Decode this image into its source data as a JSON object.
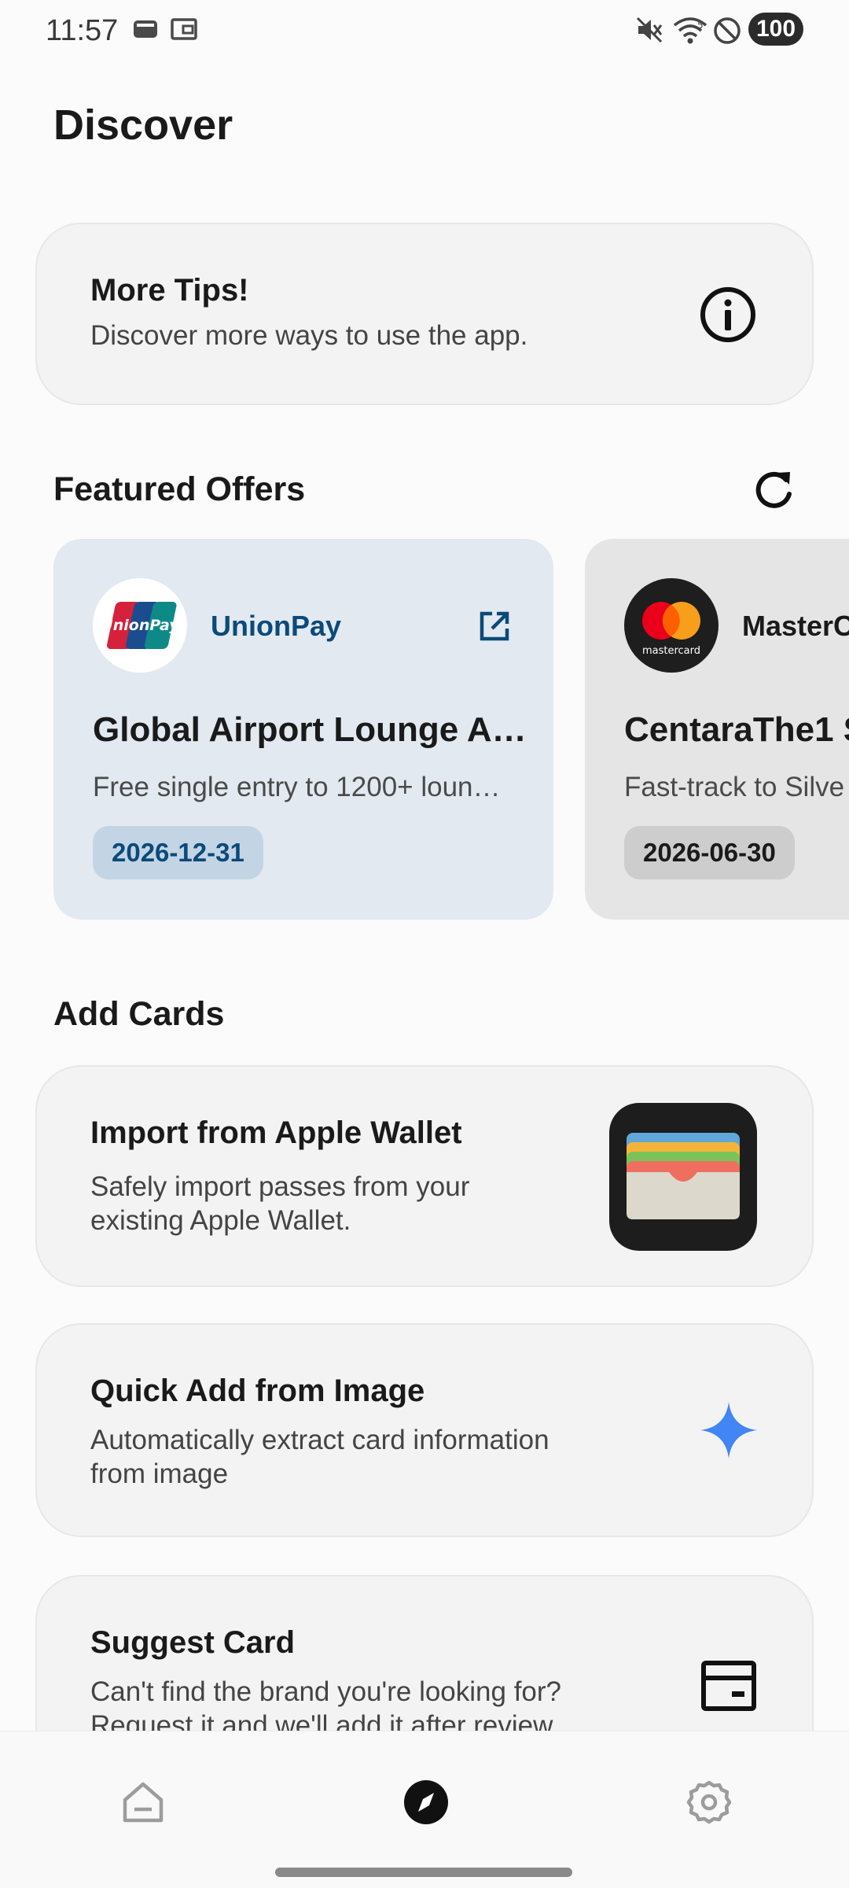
{
  "status_bar": {
    "time": "11:57",
    "battery": "100",
    "icons": [
      "sim-card-icon",
      "wallet-notification-icon",
      "mute-icon",
      "wifi-icon",
      "do-not-disturb-icon"
    ]
  },
  "page": {
    "title": "Discover"
  },
  "tips": {
    "title": "More Tips!",
    "description": "Discover more ways to use the app.",
    "icon": "info-icon"
  },
  "featured_offers": {
    "title": "Featured Offers",
    "refresh_icon": "refresh-icon",
    "offers": [
      {
        "brand": "UnionPay",
        "logo_text": "UnionPay",
        "title": "Global Airport Lounge A…",
        "description": "Free single entry to 1200+ loun…",
        "date": "2026-12-31",
        "background": "#e2e9f0",
        "brand_color": "#0b4a7a",
        "date_bg": "#c3d5e4",
        "icon": "external-link-icon"
      },
      {
        "brand": "MasterC",
        "logo_text": "mastercard",
        "title": "CentaraThe1 S",
        "description": "Fast-track to Silve",
        "date": "2026-06-30",
        "background": "#e5e5e5",
        "brand_color": "#1a1a1a",
        "date_bg": "#cdcdcd"
      }
    ]
  },
  "add_cards": {
    "title": "Add Cards",
    "items": [
      {
        "title": "Import from Apple Wallet",
        "description_line1": "Safely import passes from your",
        "description_line2": "existing Apple Wallet.",
        "icon": "apple-wallet-icon"
      },
      {
        "title": "Quick Add from Image",
        "description_line1": "Automatically extract card information",
        "description_line2": "from image",
        "icon": "sparkle-icon"
      },
      {
        "title": "Suggest Card",
        "description_line1": "Can't find the brand you're looking for?",
        "description_line2": "Request it and we'll add it after review.",
        "icon": "card-icon"
      }
    ]
  },
  "bottom_nav": {
    "items": [
      {
        "name": "home",
        "icon": "home-icon",
        "active": false
      },
      {
        "name": "discover",
        "icon": "compass-icon",
        "active": true
      },
      {
        "name": "settings",
        "icon": "gear-icon",
        "active": false
      }
    ]
  },
  "colors": {
    "accent_blue": "#4285f4",
    "background": "#fbfbfb",
    "card_background": "#f3f3f3"
  }
}
